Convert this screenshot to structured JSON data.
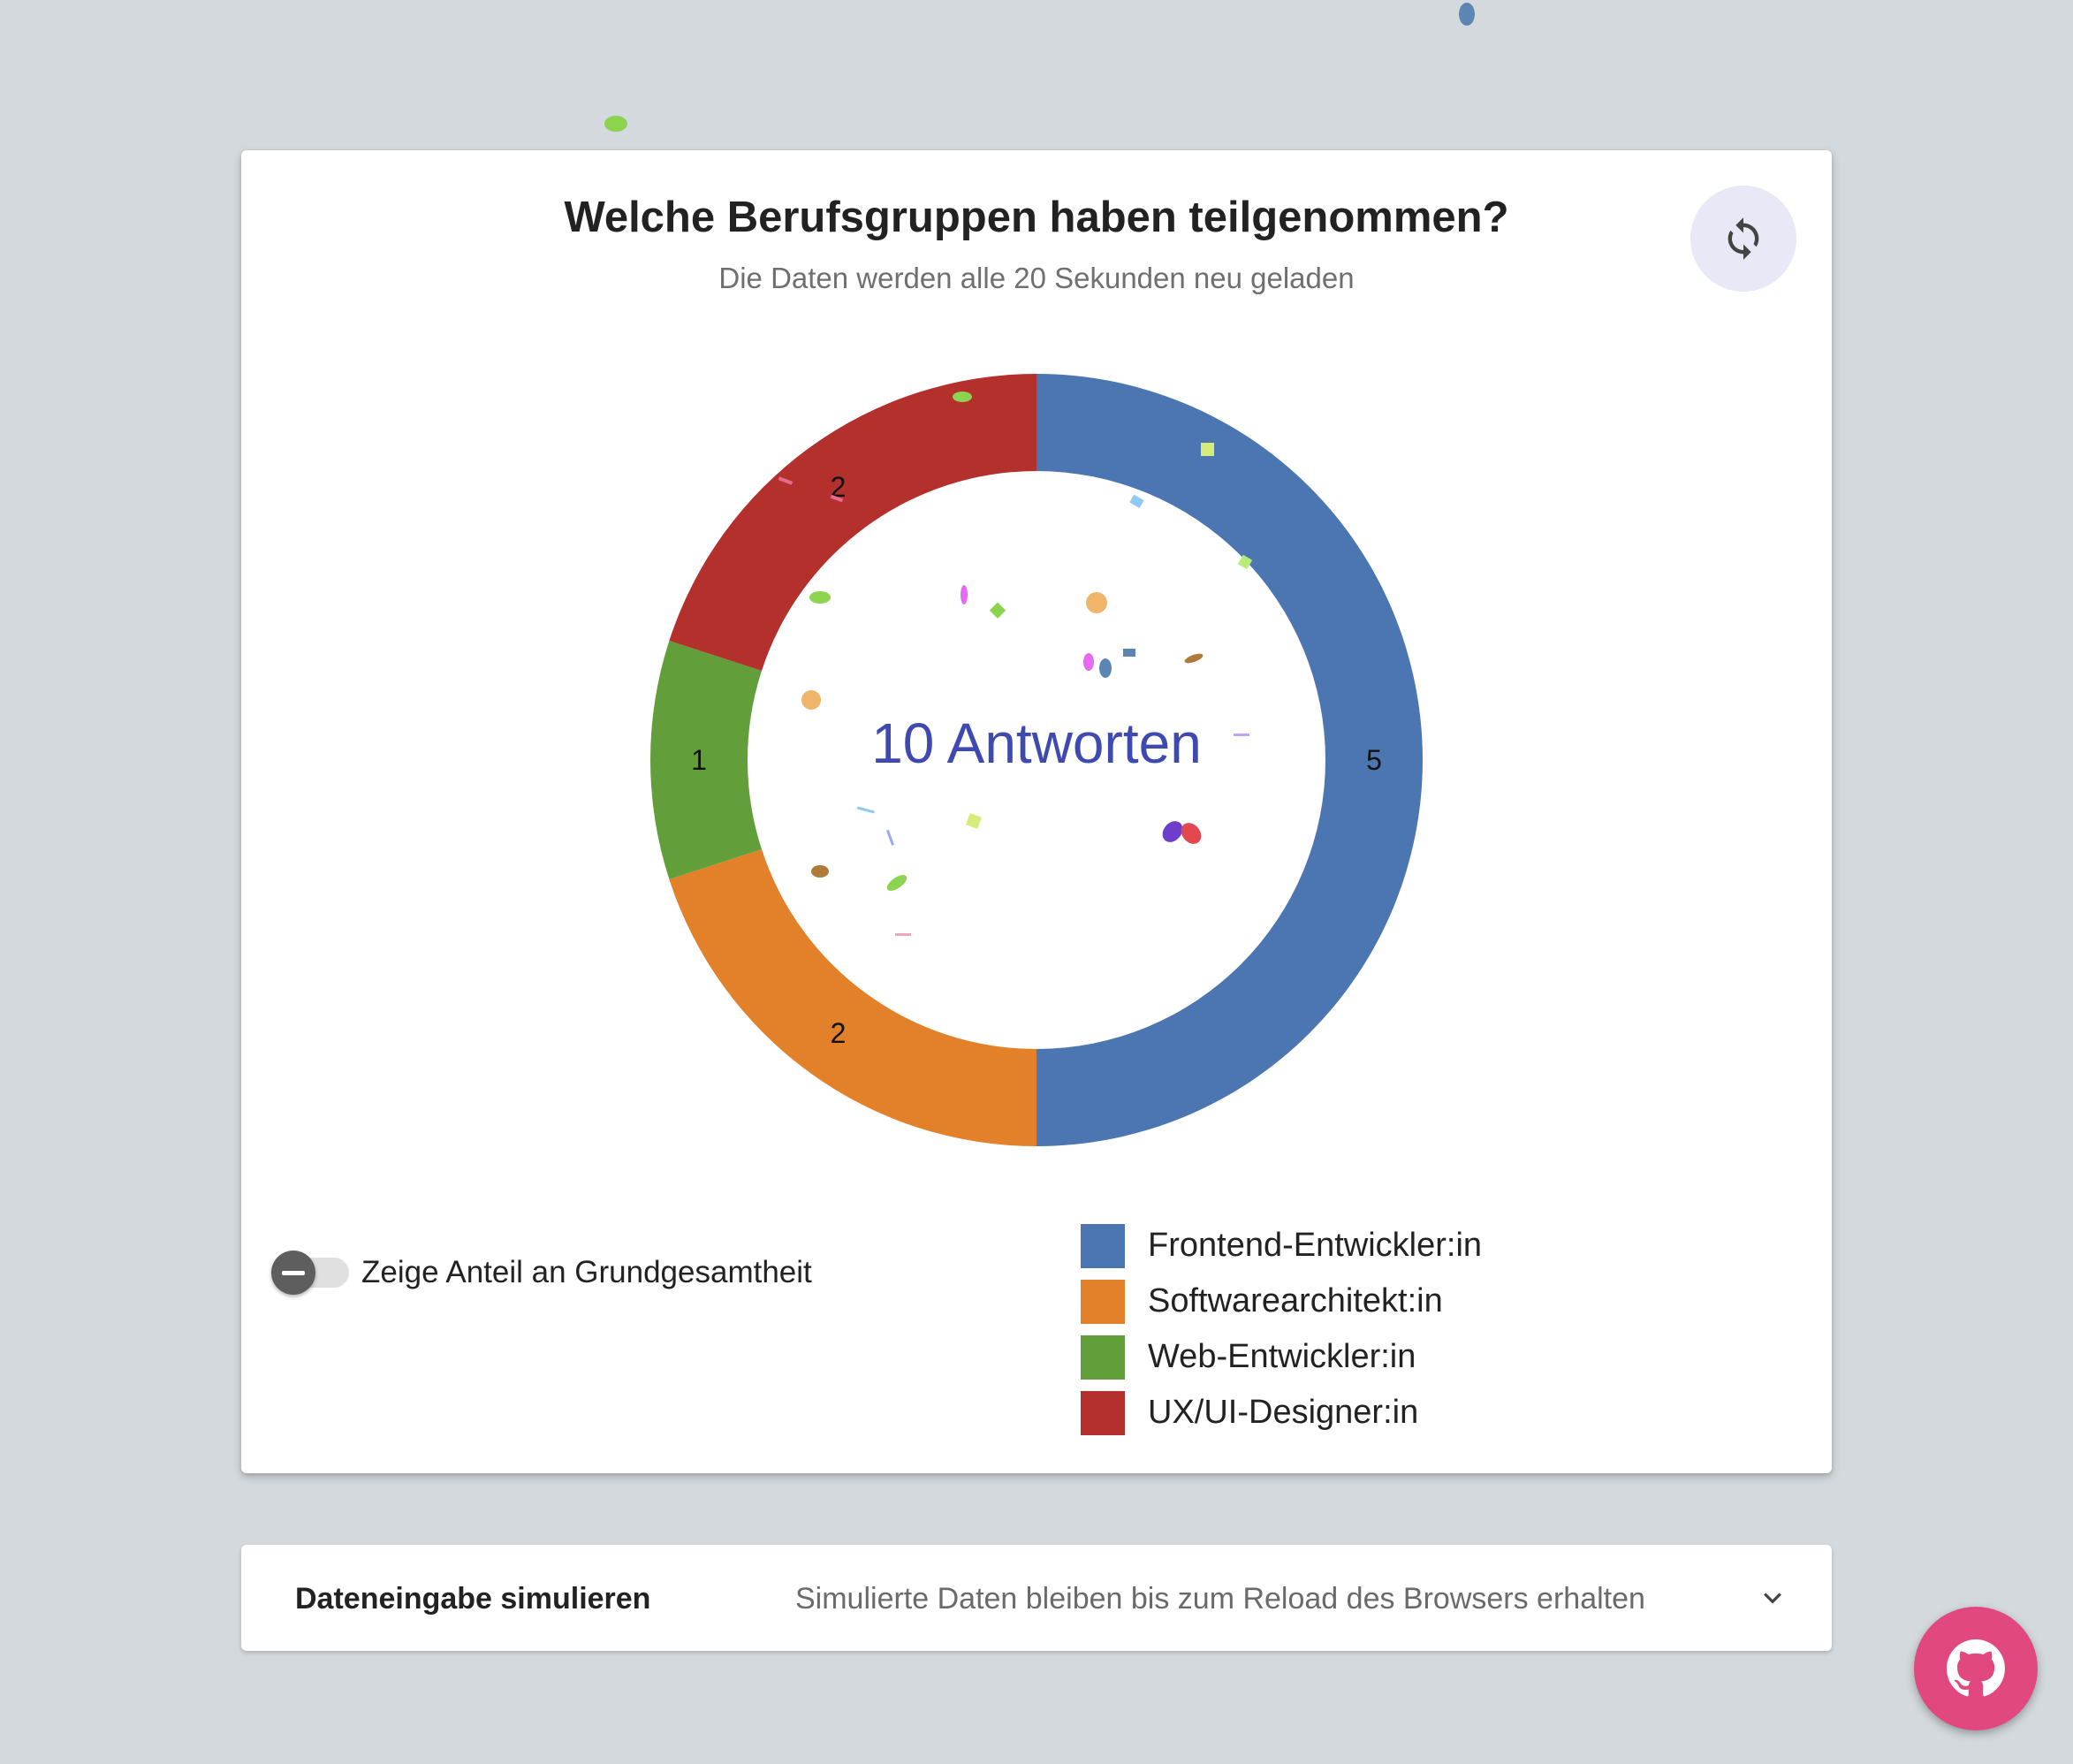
{
  "card": {
    "title": "Welche Berufsgruppen haben teilgenommen?",
    "subtitle": "Die Daten werden alle 20 Sekunden neu geladen",
    "refresh_icon": "refresh-icon"
  },
  "chart_data": {
    "type": "pie",
    "categories": [
      "Frontend-Entwickler:in",
      "Softwarearchitekt:in",
      "Web-Entwickler:in",
      "UX/UI-Designer:in"
    ],
    "values": [
      5,
      2,
      1,
      2
    ],
    "colors": [
      "#4c76b2",
      "#e2812a",
      "#629f3b",
      "#b3302d"
    ],
    "center_label": "10 Antworten",
    "donut": true,
    "legend_placement": "bottom-right"
  },
  "toggle": {
    "label": "Zeige Anteil an Grundgesamtheit",
    "checked": false
  },
  "accordion": {
    "title": "Dateneingabe simulieren",
    "description": "Simulierte Daten bleiben bis zum Reload des Browsers erhalten",
    "icon": "chevron-down-icon"
  },
  "fab": {
    "icon": "github-icon"
  }
}
